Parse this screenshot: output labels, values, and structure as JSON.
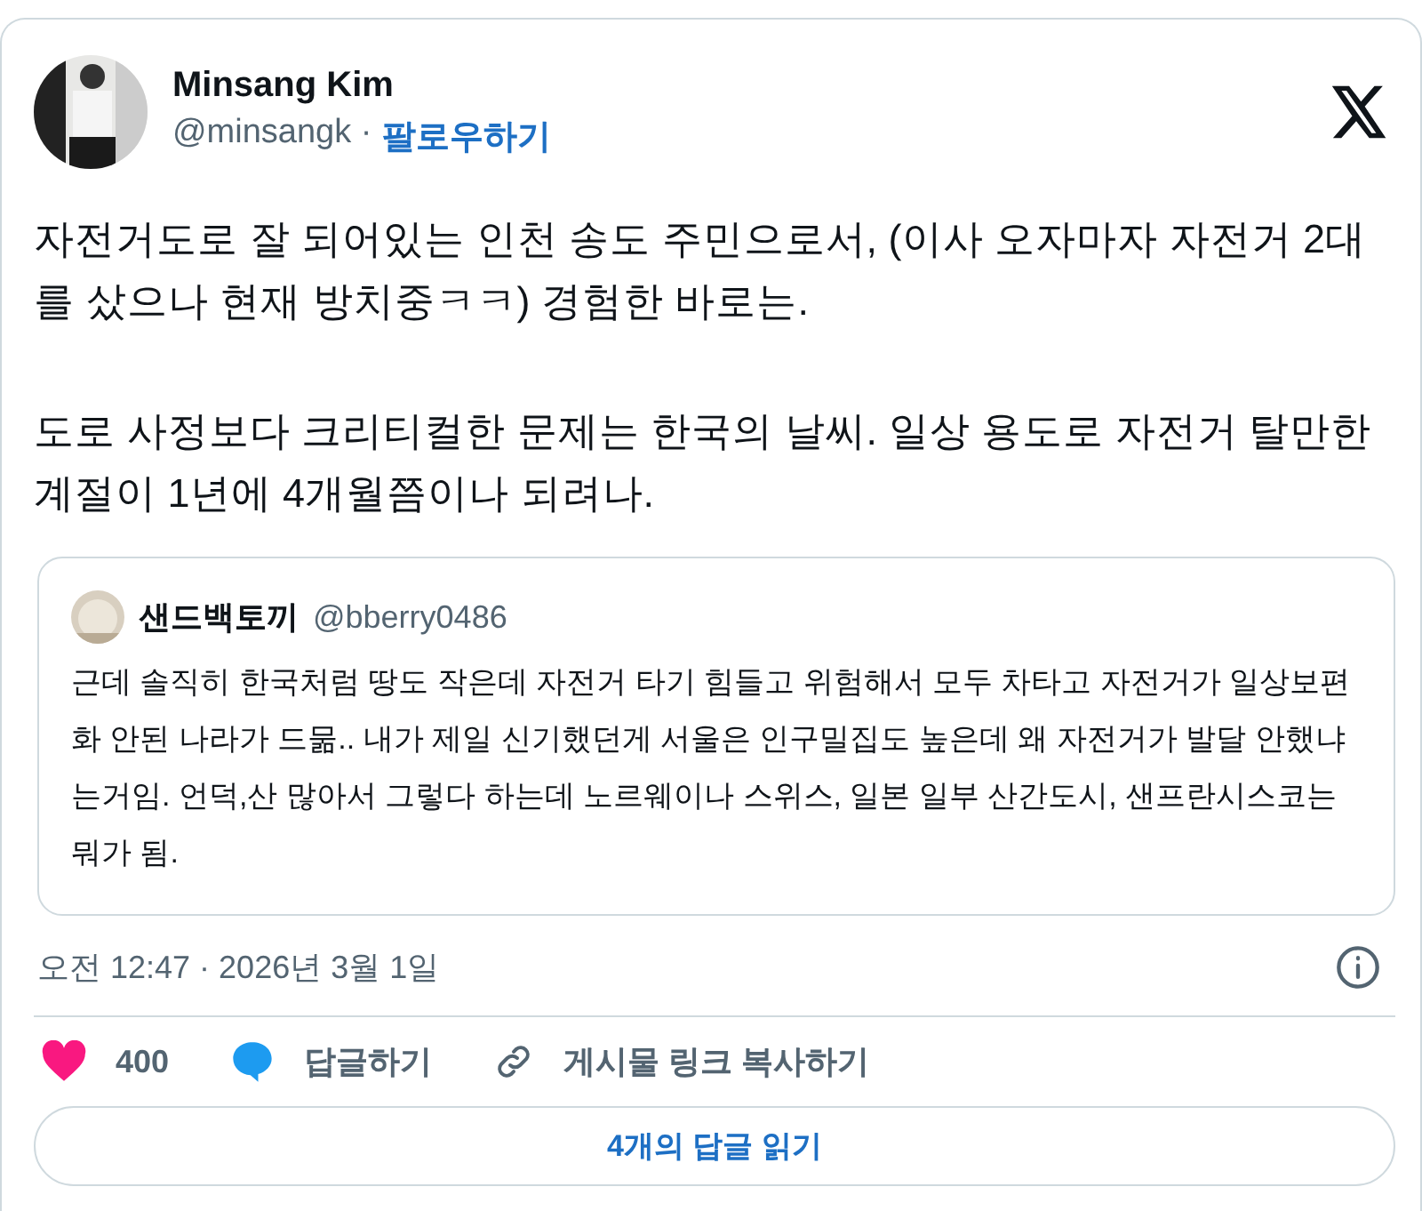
{
  "author": {
    "name": "Minsang Kim",
    "handle": "@minsangk",
    "separator": "·",
    "follow": "팔로우하기"
  },
  "body": [
    "자전거도로 잘 되어있는 인천 송도 주민으로서, (이사 오자마자 자전거 2대를 샀으나 현재 방치중ㅋㅋ) 경험한 바로는.",
    "도로 사정보다 크리티컬한 문제는 한국의 날씨. 일상 용도로 자전거 탈만한 계절이 1년에 4개월쯤이나 되려나."
  ],
  "quote": {
    "name": "샌드백토끼",
    "handle": "@bberry0486",
    "text": "근데 솔직히 한국처럼 땅도 작은데 자전거 타기 힘들고 위험해서 모두 차타고 자전거가 일상보편화 안된 나라가 드묾.. 내가 제일 신기했던게 서울은 인구밀집도 높은데 왜 자전거가 발달 안했냐는거임. 언덕,산 많아서 그렇다 하는데 노르웨이나 스위스, 일본 일부 산간도시, 샌프란시스코는 뭐가 됨."
  },
  "timestamp": "오전 12:47 · 2026년 3월 1일",
  "actions": [
    {
      "kind": "like",
      "label": "400"
    },
    {
      "kind": "reply",
      "label": "답글하기"
    },
    {
      "kind": "link",
      "label": "게시물 링크 복사하기"
    }
  ],
  "read_replies": "4개의 답글 읽기"
}
